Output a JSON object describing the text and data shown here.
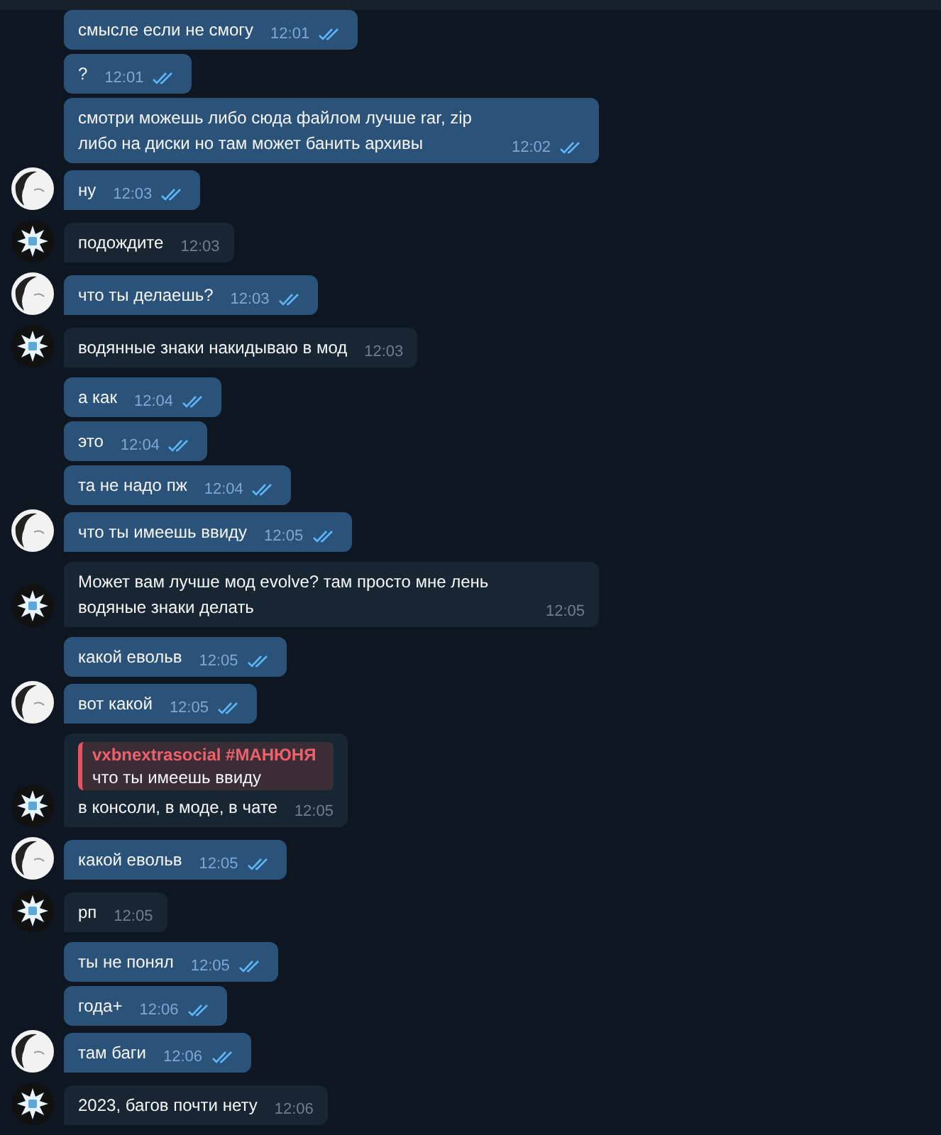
{
  "messages": [
    {
      "kind": "out",
      "text": "смысле если не смогу",
      "time": "12:01",
      "read": true,
      "avatar": false
    },
    {
      "kind": "out",
      "text": "?",
      "time": "12:01",
      "read": true,
      "avatar": false
    },
    {
      "kind": "out",
      "text": "смотри можешь либо сюда файлом лучше rar, zip либо на диски но там может банить архивы",
      "time": "12:02",
      "read": true,
      "avatar": false
    },
    {
      "kind": "out",
      "text": "ну",
      "time": "12:03",
      "read": true,
      "avatar": true
    },
    {
      "kind": "in",
      "text": "подождите",
      "time": "12:03",
      "avatar": true
    },
    {
      "kind": "out",
      "text": "что ты делаешь?",
      "time": "12:03",
      "read": true,
      "avatar": true
    },
    {
      "kind": "in",
      "text": "водянные знаки накидываю в мод",
      "time": "12:03",
      "avatar": true
    },
    {
      "kind": "out",
      "text": "а как",
      "time": "12:04",
      "read": true,
      "avatar": false
    },
    {
      "kind": "out",
      "text": "это",
      "time": "12:04",
      "read": true,
      "avatar": false
    },
    {
      "kind": "out",
      "text": "та не надо пж",
      "time": "12:04",
      "read": true,
      "avatar": false
    },
    {
      "kind": "out",
      "text": "что ты имеешь ввиду",
      "time": "12:05",
      "read": true,
      "avatar": true
    },
    {
      "kind": "in",
      "text": "Может вам лучше мод evolve? там просто мне лень водяные знаки делать",
      "time": "12:05",
      "avatar": true
    },
    {
      "kind": "out",
      "text": "какой евольв",
      "time": "12:05",
      "read": true,
      "avatar": false
    },
    {
      "kind": "out",
      "text": "вот какой",
      "time": "12:05",
      "read": true,
      "avatar": true
    },
    {
      "kind": "in",
      "text": "в консоли, в моде, в чате",
      "time": "12:05",
      "avatar": true,
      "reply": {
        "author": "vxbnextrasocial #МАНЮНЯ",
        "text": "что ты имеешь ввиду"
      }
    },
    {
      "kind": "out",
      "text": "какой евольв",
      "time": "12:05",
      "read": true,
      "avatar": true
    },
    {
      "kind": "in",
      "text": "рп",
      "time": "12:05",
      "avatar": true
    },
    {
      "kind": "out",
      "text": "ты не понял",
      "time": "12:05",
      "read": true,
      "avatar": false
    },
    {
      "kind": "out",
      "text": "года+",
      "time": "12:06",
      "read": true,
      "avatar": false
    },
    {
      "kind": "out",
      "text": "там баги",
      "time": "12:06",
      "read": true,
      "avatar": true
    },
    {
      "kind": "in",
      "text": "2023, багов почти нету",
      "time": "12:06",
      "avatar": true
    }
  ]
}
